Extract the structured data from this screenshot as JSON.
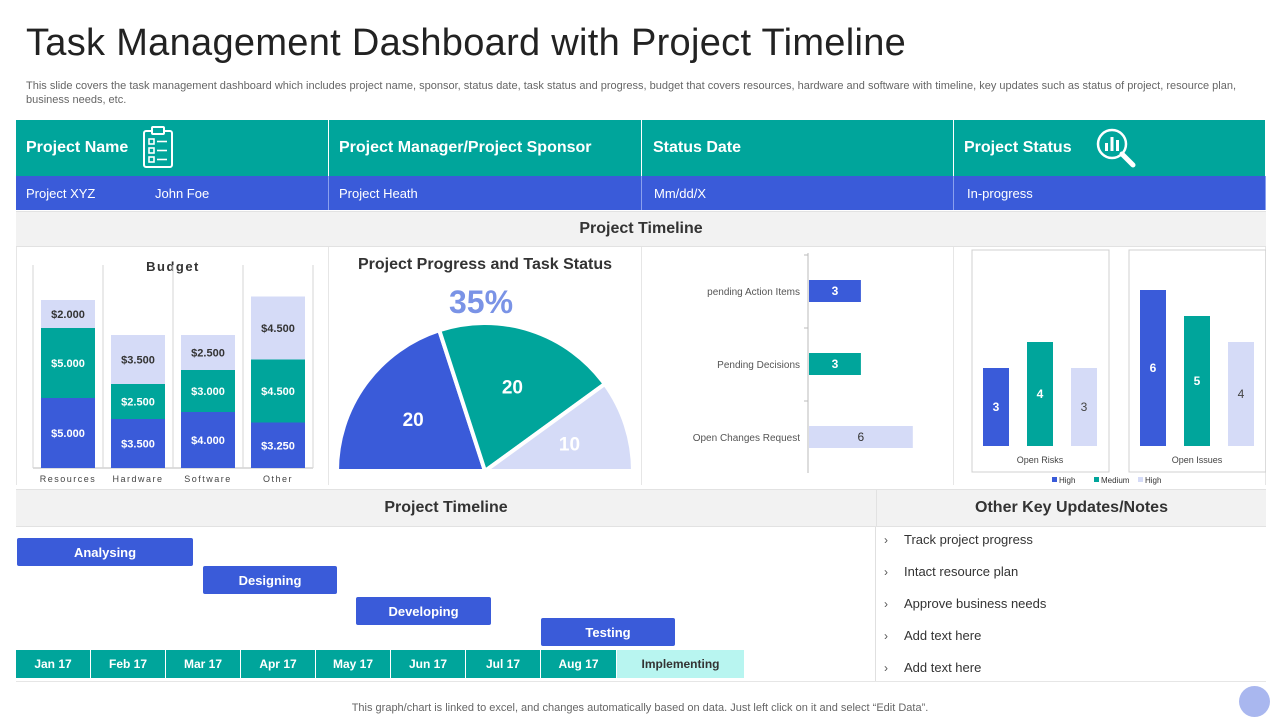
{
  "title": "Task Management Dashboard with Project Timeline",
  "subtitle": "This slide covers the task management dashboard which includes project name, sponsor, status date, task status and progress, budget that covers resources, hardware and software with timeline, key updates such as status of project, resource plan, business needs, etc.",
  "header": {
    "columns": [
      "Project Name",
      "Project Manager/Project Sponsor",
      "Status Date",
      "Project Status"
    ],
    "values": {
      "project": "Project XYZ",
      "owner": "John Foe",
      "manager": "Project Heath",
      "date": "Mm/dd/X",
      "status": "In-progress"
    }
  },
  "timeline_band_top": "Project Timeline",
  "timeline_band_bottom": "Project Timeline",
  "notes_band": "Other Key Updates/Notes",
  "notes": [
    "Track project progress",
    "Intact resource plan",
    "Approve  business needs",
    "Add text here",
    "Add text here"
  ],
  "gantt": {
    "tasks": [
      {
        "label": "Analysing",
        "start": "Jan 17",
        "end": "Mar 17"
      },
      {
        "label": "Designing",
        "start": "Mar 17",
        "end": "Apr 17"
      },
      {
        "label": "Developing",
        "start": "May 17",
        "end": "Jul 17"
      },
      {
        "label": "Testing",
        "start": "Jul 17",
        "end": "Sep 17"
      }
    ],
    "months": [
      "Jan 17",
      "Feb 17",
      "Mar 17",
      "Apr 17",
      "May 17",
      "Jun 17",
      "Jul 17",
      "Aug 17"
    ],
    "implementing_label": "Implementing"
  },
  "colors": {
    "teal": "#00A59B",
    "blue": "#3A5BD9",
    "light": "#D5DBF7",
    "lightteal": "#B8F5F0"
  },
  "footer": "This graph/chart is linked to excel,  and changes automatically based on data. Just left click on it and select “Edit Data”.",
  "chart_data": [
    {
      "type": "bar",
      "title": "Budget",
      "stacked": true,
      "categories": [
        "Resources",
        "Hardware",
        "Software",
        "Other"
      ],
      "series": [
        {
          "values": [
            5000,
            3500,
            4000,
            3250
          ],
          "labels": [
            "$5.000",
            "$3.500",
            "$4.000",
            "$3.250"
          ],
          "color": "#3A5BD9"
        },
        {
          "values": [
            5000,
            2500,
            3000,
            4500
          ],
          "labels": [
            "$5.000",
            "$2.500",
            "$3.000",
            "$4.500"
          ],
          "color": "#00A59B"
        },
        {
          "values": [
            2000,
            3500,
            2500,
            4500
          ],
          "labels": [
            "$2.000",
            "$3.500",
            "$2.500",
            "$4.500"
          ],
          "color": "#D5DBF7"
        }
      ]
    },
    {
      "type": "pie",
      "title": "Project Progress and Task Status",
      "headline": "35%",
      "half": true,
      "slices": [
        {
          "value": 20,
          "label": "20",
          "color": "#3A5BD9"
        },
        {
          "value": 20,
          "label": "20",
          "color": "#00A59B"
        },
        {
          "value": 10,
          "label": "10",
          "color": "#D5DBF7"
        }
      ]
    },
    {
      "type": "bar",
      "orientation": "horizontal",
      "categories": [
        "pending Action Items",
        "Pending Decisions",
        "Open Changes Request"
      ],
      "values": [
        3,
        3,
        6
      ],
      "colors": [
        "#3A5BD9",
        "#00A59B",
        "#D5DBF7"
      ]
    },
    {
      "type": "bar",
      "xlabel": "Open Risks",
      "categories": [
        "High",
        "Medium",
        "High"
      ],
      "values": [
        3,
        4,
        3
      ],
      "colors": [
        "#3A5BD9",
        "#00A59B",
        "#D5DBF7"
      ]
    },
    {
      "type": "bar",
      "xlabel": "Open Issues",
      "categories": [
        "High",
        "Medium",
        "High"
      ],
      "values": [
        6,
        5,
        4
      ],
      "colors": [
        "#3A5BD9",
        "#00A59B",
        "#D5DBF7"
      ]
    }
  ],
  "legend": [
    "High",
    "Medium",
    "High"
  ]
}
